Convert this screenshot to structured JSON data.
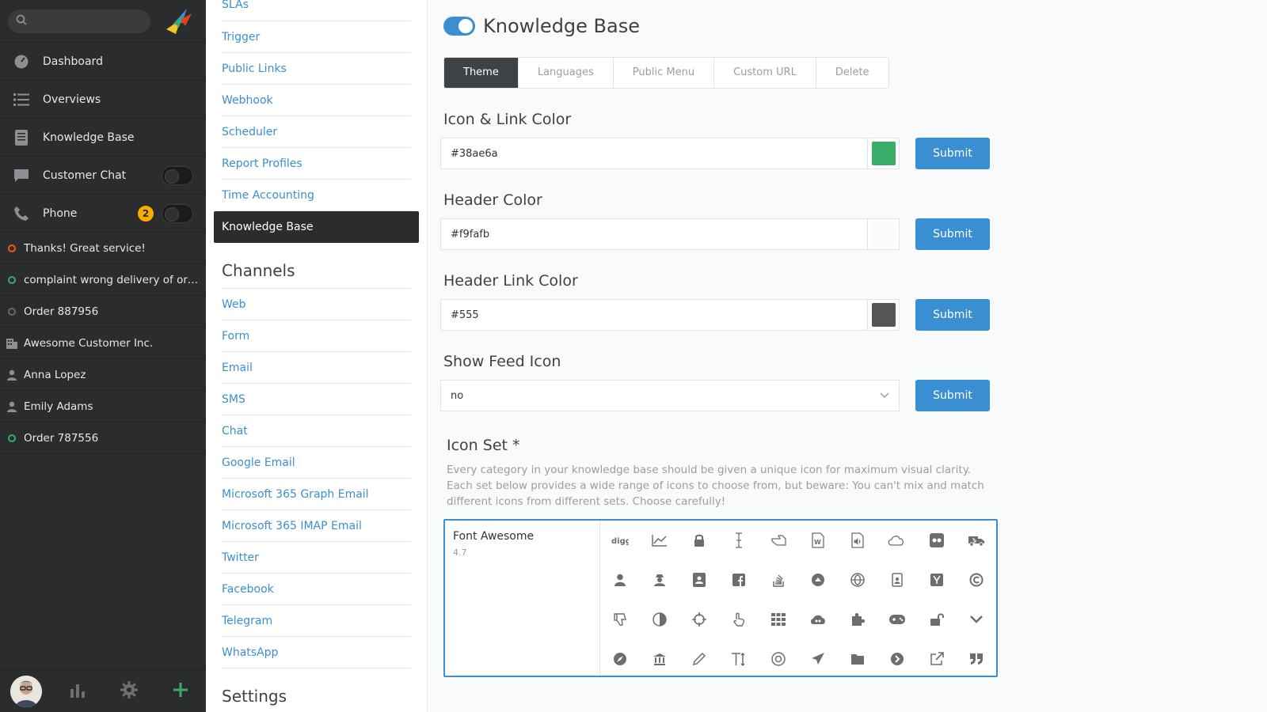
{
  "sidebar": {
    "search": {
      "placeholder": ""
    },
    "nav": [
      {
        "label": "Dashboard",
        "icon": "dashboard-icon"
      },
      {
        "label": "Overviews",
        "icon": "list-icon"
      },
      {
        "label": "Knowledge Base",
        "icon": "book-icon"
      },
      {
        "label": "Customer Chat",
        "icon": "chat-icon"
      },
      {
        "label": "Phone",
        "icon": "phone-icon",
        "badge": "2"
      }
    ],
    "tasks": [
      {
        "label": "Thanks! Great service!",
        "icon": "ticket-open-icon",
        "color": "#f35912"
      },
      {
        "label": "complaint wrong delivery of order",
        "icon": "ticket-open-icon",
        "color": "#38ad69"
      },
      {
        "label": "Order 887956",
        "icon": "ticket-closed-icon",
        "color": "#666666"
      },
      {
        "label": "Awesome Customer Inc.",
        "icon": "organization-icon"
      },
      {
        "label": "Anna Lopez",
        "icon": "user-icon"
      },
      {
        "label": "Emily Adams",
        "icon": "user-icon"
      },
      {
        "label": "Order 787556",
        "icon": "ticket-open-icon",
        "color": "#38ad69"
      }
    ]
  },
  "menu": {
    "manage_links": [
      "SLAs",
      "Trigger",
      "Public Links",
      "Webhook",
      "Scheduler",
      "Report Profiles",
      "Time Accounting",
      "Knowledge Base"
    ],
    "channels_heading": "Channels",
    "channel_links": [
      "Web",
      "Form",
      "Email",
      "SMS",
      "Chat",
      "Google Email",
      "Microsoft 365 Graph Email",
      "Microsoft 365 IMAP Email",
      "Twitter",
      "Facebook",
      "Telegram",
      "WhatsApp"
    ],
    "settings_heading": "Settings"
  },
  "main": {
    "title": "Knowledge Base",
    "tabs": [
      "Theme",
      "Languages",
      "Public Menu",
      "Custom URL",
      "Delete"
    ],
    "icon_link_color": {
      "title": "Icon & Link Color",
      "value": "#38ae6a",
      "swatch": "#38ae6a"
    },
    "header_color": {
      "title": "Header Color",
      "value": "#f9fafb",
      "swatch": "#f9fafb"
    },
    "header_link_color": {
      "title": "Header Link Color",
      "value": "#555",
      "swatch": "#555555"
    },
    "show_feed_icon": {
      "title": "Show Feed Icon",
      "value": "no"
    },
    "submit_label": "Submit",
    "icon_set": {
      "title": "Icon Set *",
      "description": "Every category in your knowledge base should be given a unique icon for maximum visual clarity. Each set below provides a wide range of icons to choose from, but beware: You can't mix and match different icons from different sets. Choose carefully!",
      "name": "Font Awesome",
      "version": "4.7"
    }
  },
  "colors": {
    "accent": "#3a8fd2",
    "sidebar_bg": "#2b2c2e",
    "badge": "#faab00"
  }
}
